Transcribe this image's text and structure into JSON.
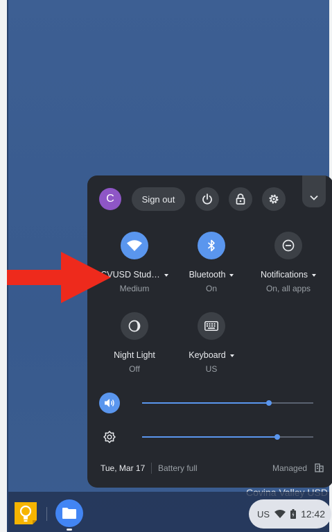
{
  "desktop": {
    "org_label": "Covina Valley USD"
  },
  "quick_settings": {
    "user_initial": "C",
    "sign_out_label": "Sign out",
    "tiles": {
      "network": {
        "label": "CVUSD Stud…",
        "sub": "Medium",
        "icon": "wifi-icon",
        "on": true
      },
      "bluetooth": {
        "label": "Bluetooth",
        "sub": "On",
        "icon": "bluetooth-icon",
        "on": true
      },
      "notifications": {
        "label": "Notifications",
        "sub": "On, all apps",
        "icon": "do-not-disturb-icon",
        "on": false
      },
      "night_light": {
        "label": "Night Light",
        "sub": "Off",
        "icon": "night-light-icon",
        "on": false
      },
      "keyboard": {
        "label": "Keyboard",
        "sub": "US",
        "icon": "keyboard-icon",
        "on": false
      }
    },
    "volume_level": 0.74,
    "brightness_level": 0.79,
    "footer": {
      "date": "Tue, Mar 17",
      "battery": "Battery full",
      "managed": "Managed"
    }
  },
  "shelf": {
    "apps": [
      {
        "name": "Google Keep",
        "icon": "keep-icon"
      },
      {
        "name": "Files",
        "icon": "files-icon"
      }
    ],
    "status": {
      "input_method": "US",
      "time": "12:42"
    }
  },
  "colors": {
    "accent": "#5a96ee",
    "panel": "#25282e",
    "arrow": "#ee2a1c",
    "wallpaper": "#3a5a8c"
  }
}
